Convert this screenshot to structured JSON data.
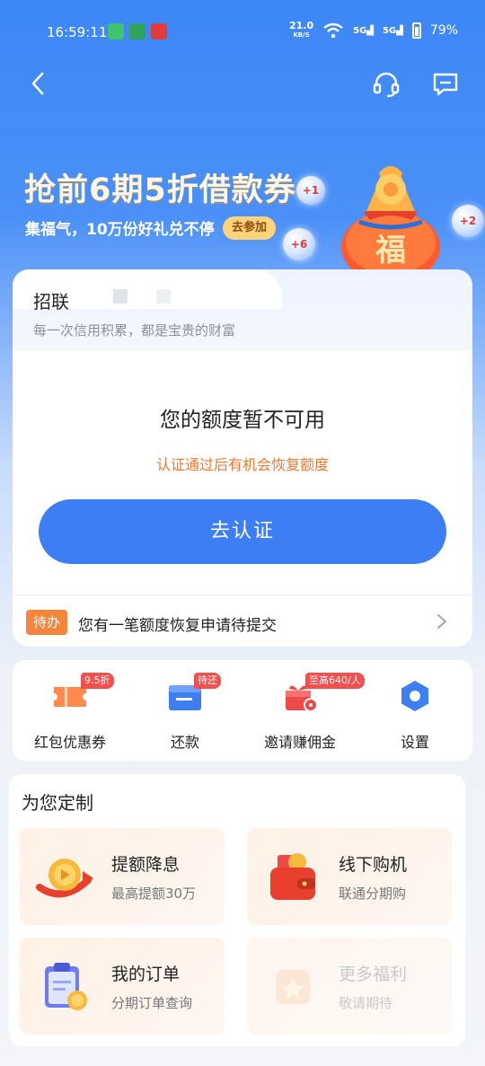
{
  "status_bar": {
    "time": "16:59:11",
    "net_speed": "21.0",
    "net_unit": "KB/S",
    "signal1": "5G",
    "signal2": "5G",
    "battery": "79%"
  },
  "nav": {
    "back_icon": "chevron-left-icon",
    "service_icon": "headset-icon",
    "message_icon": "message-icon"
  },
  "banner": {
    "title": "抢前6期5折借款券",
    "subtitle": "集福气，10万份好礼兑不停",
    "button": "去参加",
    "bubbles": [
      "+1",
      "+2",
      "+6"
    ],
    "bag_char": "福"
  },
  "card": {
    "name": "招联",
    "slogan": "每一次信用积累，都是宝贵的财富",
    "quota_title": "您的额度暂不可用",
    "quota_sub": "认证通过后有机会恢复额度",
    "verify_button": "去认证",
    "todo_tag": "待办",
    "todo_text": "您有一笔额度恢复申请待提交"
  },
  "shortcuts": [
    {
      "label": "红包优惠券",
      "badge": "9.5折",
      "icon": "coupon-icon"
    },
    {
      "label": "还款",
      "badge": "待还",
      "icon": "repay-icon"
    },
    {
      "label": "邀请赚佣金",
      "badge": "至高640/人",
      "icon": "gift-icon"
    },
    {
      "label": "设置",
      "badge": "",
      "icon": "gear-icon"
    }
  ],
  "custom": {
    "title": "为您定制",
    "tiles": [
      {
        "title": "提额降息",
        "sub": "最高提额30万",
        "icon": "coin-arrow-icon"
      },
      {
        "title": "线下购机",
        "sub": "联通分期购",
        "icon": "wallet-icon"
      },
      {
        "title": "我的订单",
        "sub": "分期订单查询",
        "icon": "clipboard-icon"
      },
      {
        "title": "更多福利",
        "sub": "敬请期待",
        "icon": "star-icon"
      }
    ]
  },
  "colors": {
    "primary": "#3d7ef4",
    "accent_orange": "#f07a33",
    "badge_red": "#f24f4f"
  }
}
